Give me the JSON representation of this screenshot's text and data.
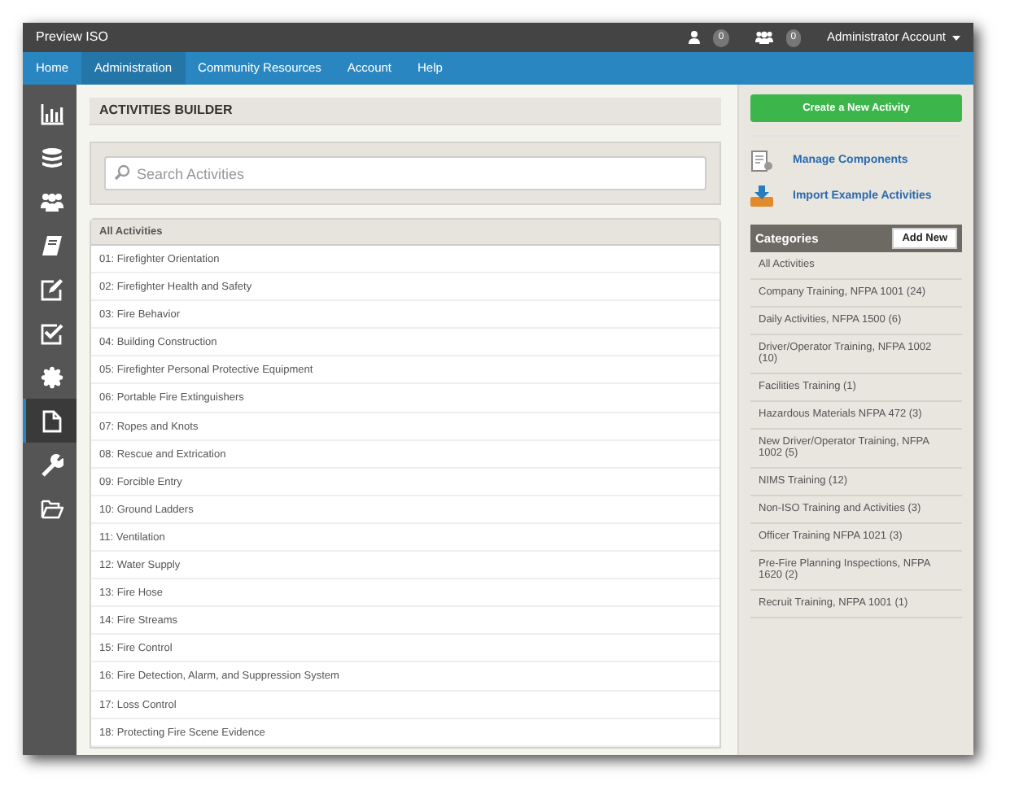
{
  "app_title": "Preview ISO",
  "top_bar": {
    "user_count": "0",
    "group_count": "0",
    "account": "Administrator Account"
  },
  "nav": [
    {
      "label": "Home",
      "selected": false
    },
    {
      "label": "Administration",
      "selected": true
    },
    {
      "label": "Community Resources",
      "selected": false
    },
    {
      "label": "Account",
      "selected": false
    },
    {
      "label": "Help",
      "selected": false
    }
  ],
  "sidebar": [
    {
      "kind": "chart",
      "selected": false
    },
    {
      "kind": "database",
      "selected": false
    },
    {
      "kind": "users",
      "selected": false
    },
    {
      "kind": "book",
      "selected": false
    },
    {
      "kind": "edit",
      "selected": false
    },
    {
      "kind": "check",
      "selected": false
    },
    {
      "kind": "gear",
      "selected": false
    },
    {
      "kind": "file",
      "selected": true
    },
    {
      "kind": "wrench",
      "selected": false
    },
    {
      "kind": "folder",
      "selected": false
    }
  ],
  "title": "ACTIVITIES BUILDER",
  "search": {
    "placeholder": "Search Activities"
  },
  "list_header": "All Activities",
  "activities": [
    "01: Firefighter Orientation",
    "02: Firefighter Health and Safety",
    "03: Fire Behavior",
    "04: Building Construction",
    "05: Firefighter Personal Protective Equipment",
    "06: Portable Fire Extinguishers",
    "07: Ropes and Knots",
    "08: Rescue and Extrication",
    "09: Forcible Entry",
    "10: Ground Ladders",
    "11: Ventilation",
    "12: Water Supply",
    "13: Fire Hose",
    "14: Fire Streams",
    "15: Fire Control",
    "16: Fire Detection, Alarm, and Suppression System",
    "17: Loss Control",
    "18: Protecting Fire Scene Evidence"
  ],
  "create_button": "Create a New Activity",
  "links": [
    {
      "kind": "components",
      "label": "Manage Components"
    },
    {
      "kind": "import",
      "label": "Import Example Activities"
    }
  ],
  "categories": {
    "title": "Categories",
    "add_button": "Add New",
    "items": [
      "All Activities",
      "Company Training, NFPA 1001 (24)",
      "Daily Activities, NFPA 1500 (6)",
      "Driver/Operator Training, NFPA 1002 (10)",
      "Facilities Training (1)",
      "Hazardous Materials NFPA 472 (3)",
      "New Driver/Operator Training, NFPA 1002 (5)",
      "NIMS Training (12)",
      "Non-ISO Training and Activities (3)",
      "Officer Training NFPA 1021 (3)",
      "Pre-Fire Planning Inspections, NFPA 1620 (2)",
      "Recruit Training, NFPA 1001 (1)"
    ]
  }
}
